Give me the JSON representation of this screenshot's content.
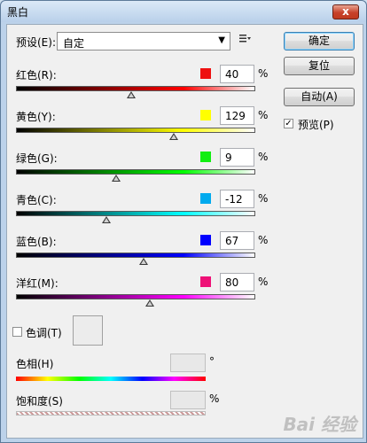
{
  "window": {
    "title": "黑白",
    "close_label": "x"
  },
  "preset": {
    "label": "预设(E):",
    "value": "自定",
    "arrow": "▼",
    "menu": "⠿"
  },
  "buttons": {
    "ok": "确定",
    "reset": "复位",
    "auto": "自动(A)"
  },
  "preview": {
    "label": "预览(P)",
    "checked": true,
    "check": "✓"
  },
  "channels": [
    {
      "label": "红色(R):",
      "value": "40",
      "unit": "%",
      "color": "#ee1111",
      "grad_start": "#000000",
      "grad_end": "#ff0000"
    },
    {
      "label": "黄色(Y):",
      "value": "129",
      "unit": "%",
      "color": "#ffff00",
      "grad_start": "#000000",
      "grad_end": "#ffff00"
    },
    {
      "label": "绿色(G):",
      "value": "9",
      "unit": "%",
      "color": "#11ee11",
      "grad_start": "#000000",
      "grad_end": "#00ff00"
    },
    {
      "label": "青色(C):",
      "value": "-12",
      "unit": "%",
      "color": "#00aaee",
      "grad_start": "#000000",
      "grad_end": "#00ffff"
    },
    {
      "label": "蓝色(B):",
      "value": "67",
      "unit": "%",
      "color": "#0000ff",
      "grad_start": "#000000",
      "grad_end": "#0000ff"
    },
    {
      "label": "洋红(M):",
      "value": "80",
      "unit": "%",
      "color": "#ee1177",
      "grad_start": "#000000",
      "grad_end": "#ff00ff"
    }
  ],
  "tint": {
    "label": "色调(T)",
    "checked": false
  },
  "hue": {
    "label": "色相(H)",
    "unit": "°"
  },
  "saturation": {
    "label": "饱和度(S)",
    "unit": "%"
  },
  "watermark": "Bai 经验"
}
